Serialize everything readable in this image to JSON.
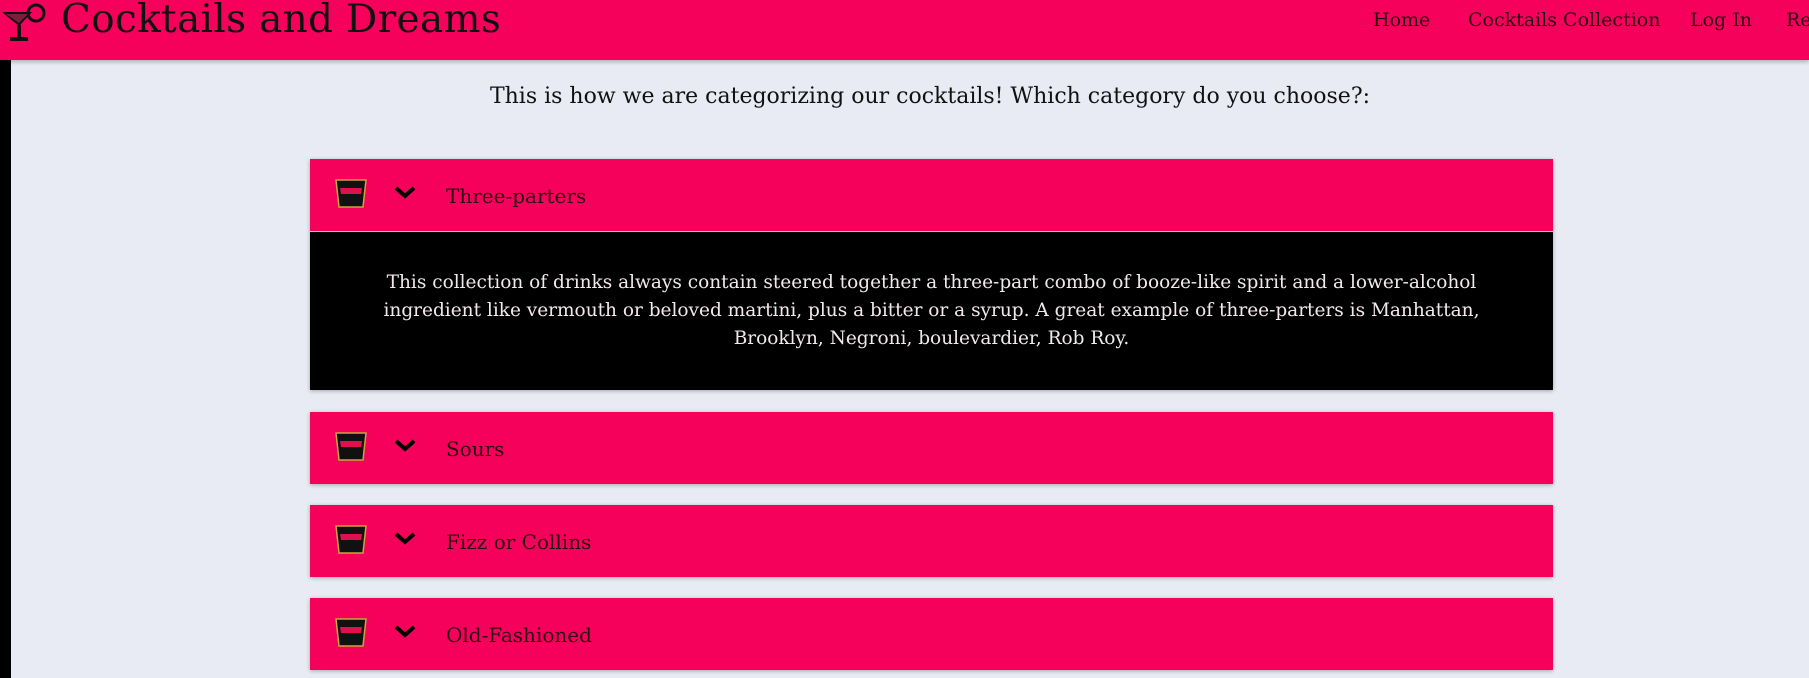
{
  "header": {
    "brand": "Cocktails and Dreams",
    "nav": [
      {
        "label": "Home"
      },
      {
        "label": "Cocktails Collection"
      },
      {
        "label": "Log In"
      },
      {
        "label": "Re"
      }
    ],
    "logo_icon": "cocktail-glass-icon",
    "accent_color": "#f5005a"
  },
  "main": {
    "intro": "This is how we are categorizing our cocktails! Which category do you choose?:",
    "categories": [
      {
        "label": "Three-parters",
        "expanded": true,
        "description": "This collection of drinks always contain steered together a three-part combo of booze-like spirit and a lower-alcohol ingredient like vermouth or beloved martini, plus a bitter or a syrup. A great example of three-parters is Manhattan, Brooklyn, Negroni, boulevardier, Rob Roy."
      },
      {
        "label": "Sours",
        "expanded": false
      },
      {
        "label": "Fizz or Collins",
        "expanded": false
      },
      {
        "label": "Old-Fashioned",
        "expanded": false
      }
    ]
  }
}
